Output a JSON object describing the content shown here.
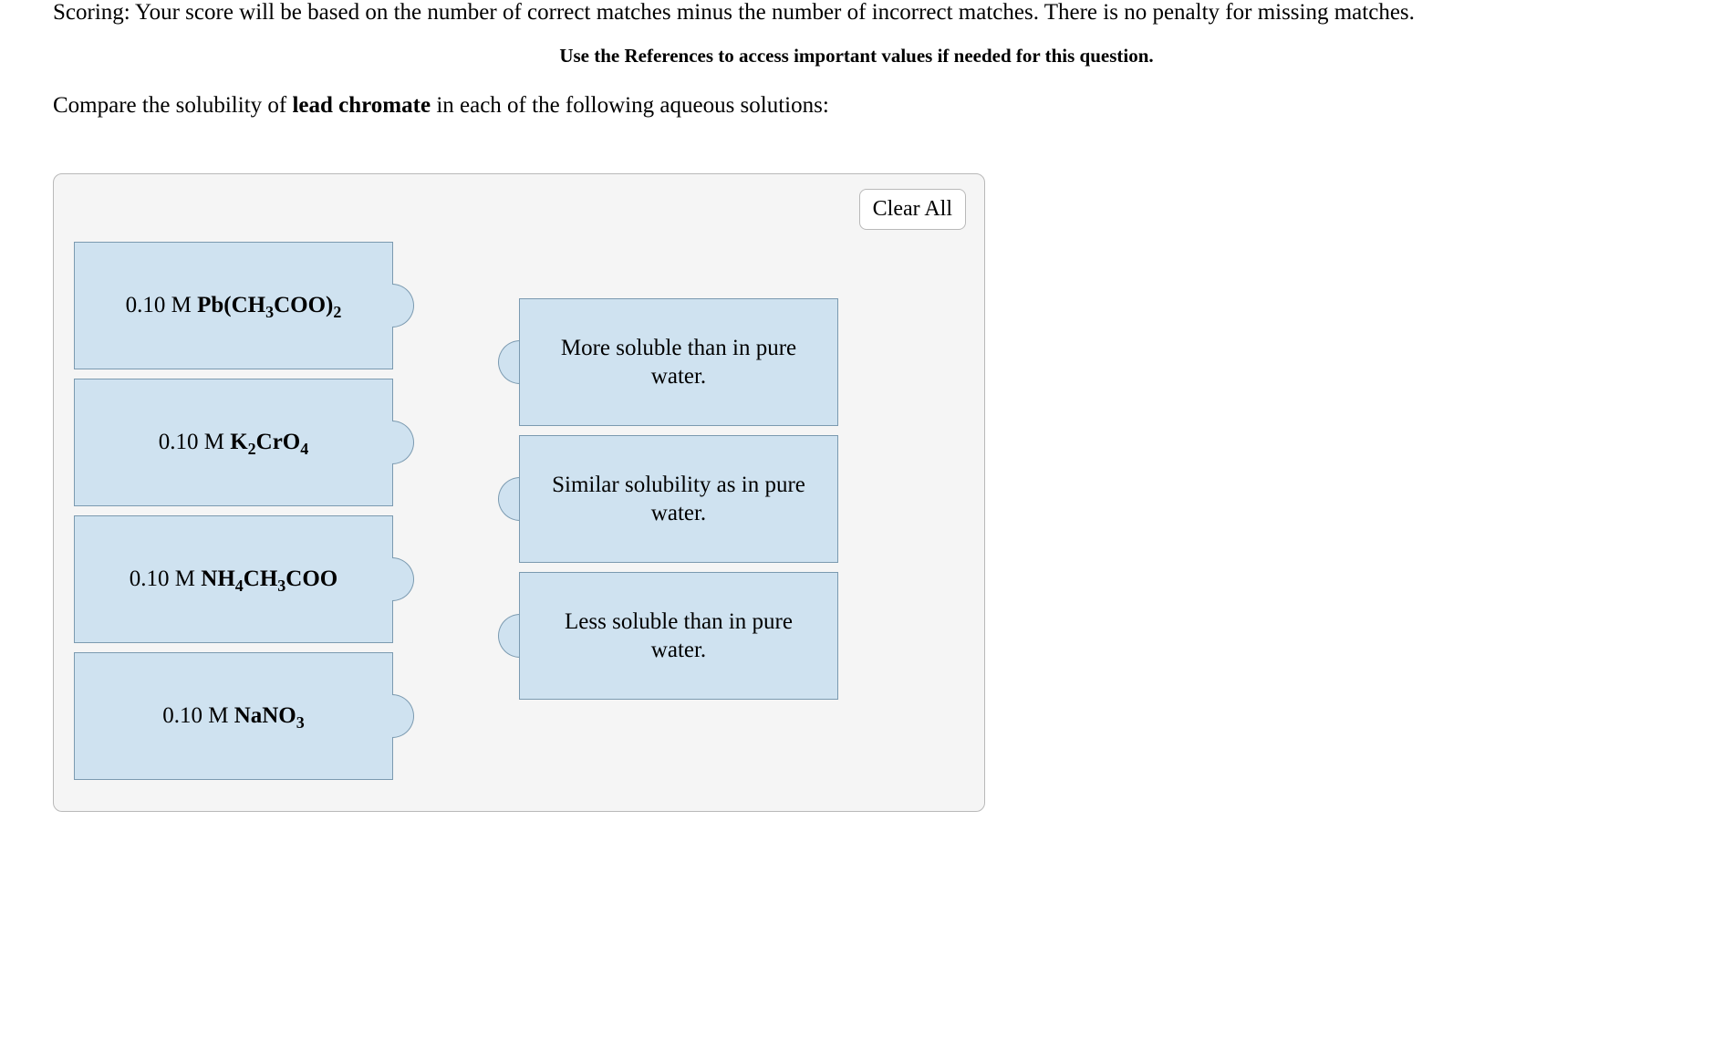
{
  "scoring_text": "Scoring: Your score will be based on the number of correct matches minus the number of incorrect matches. There is no penalty for missing matches.",
  "references_hint": "Use the References to access important values if needed for this question.",
  "prompt": {
    "pre": "Compare the solubility of ",
    "bold": "lead chromate",
    "post": " in each of the following aqueous solutions:"
  },
  "clear_all_label": "Clear All",
  "left_items": [
    {
      "prefix": "0.10 M ",
      "formula_html": "Pb(CH<sub>3</sub>COO)<sub>2</sub>"
    },
    {
      "prefix": "0.10 M ",
      "formula_html": "K<sub>2</sub>CrO<sub>4</sub>"
    },
    {
      "prefix": "0.10 M ",
      "formula_html": "NH<sub>4</sub>CH<sub>3</sub>COO"
    },
    {
      "prefix": "0.10 M ",
      "formula_html": "NaNO<sub>3</sub>"
    }
  ],
  "right_items": [
    "More soluble than in pure water.",
    "Similar solubility as in pure water.",
    "Less soluble than in pure water."
  ]
}
